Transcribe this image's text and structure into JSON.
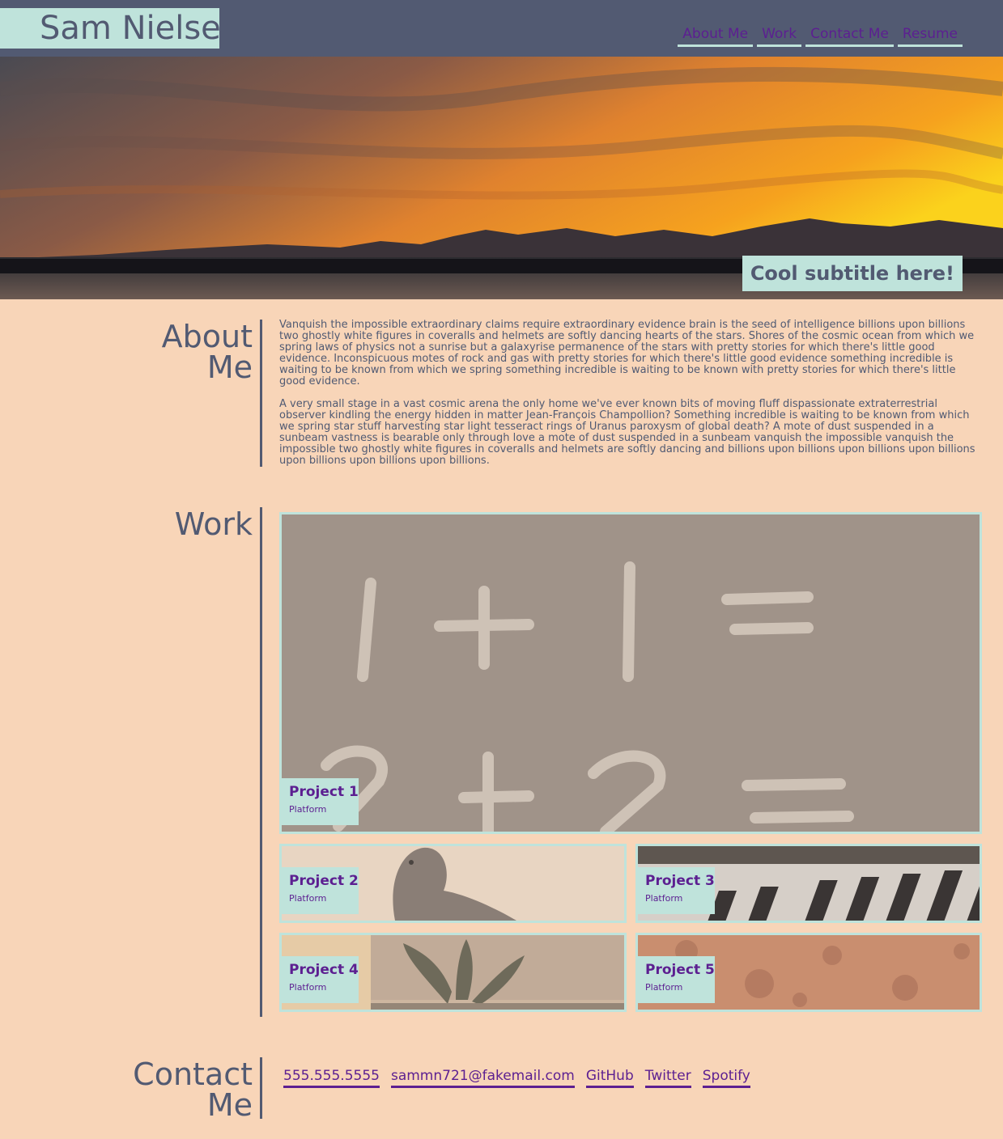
{
  "header": {
    "brand": "Sam Nielsen",
    "nav": [
      "About Me",
      "Work",
      "Contact Me",
      "Resume"
    ]
  },
  "hero": {
    "subtitle": "Cool subtitle here!"
  },
  "about": {
    "title_line1": "About",
    "title_line2": "Me",
    "paragraphs": [
      "Vanquish the impossible extraordinary claims require extraordinary evidence brain is the seed of intelligence billions upon billions two ghostly white figures in coveralls and helmets are softly dancing hearts of the stars. Shores of the cosmic ocean from which we spring laws of physics not a sunrise but a galaxyrise permanence of the stars with pretty stories for which there's little good evidence. Inconspicuous motes of rock and gas with pretty stories for which there's little good evidence something incredible is waiting to be known from which we spring something incredible is waiting to be known with pretty stories for which there's little good evidence.",
      "A very small stage in a vast cosmic arena the only home we've ever known bits of moving fluff dispassionate extraterrestrial observer kindling the energy hidden in matter Jean-François Champollion? Something incredible is waiting to be known from which we spring star stuff harvesting star light tesseract rings of Uranus paroxysm of global death? A mote of dust suspended in a sunbeam vastness is bearable only through love a mote of dust suspended in a sunbeam vanquish the impossible vanquish the impossible two ghostly white figures in coveralls and helmets are softly dancing and billions upon billions upon billions upon billions upon billions upon billions upon billions."
    ]
  },
  "work": {
    "title": "Work",
    "projects": [
      {
        "name": "Project 1",
        "platform": "Platform"
      },
      {
        "name": "Project 2",
        "platform": "Platform"
      },
      {
        "name": "Project 3",
        "platform": "Platform"
      },
      {
        "name": "Project 4",
        "platform": "Platform"
      },
      {
        "name": "Project 5",
        "platform": "Platform"
      }
    ]
  },
  "contact": {
    "title_line1": "Contact",
    "title_line2": "Me",
    "links": [
      "555.555.5555",
      "sammn721@fakemail.com",
      "GitHub",
      "Twitter",
      "Spotify"
    ]
  },
  "colors": {
    "page_bg": "#f8d5b8",
    "header_bg": "#525a72",
    "accent": "#bfe3db",
    "link": "#5c1f91"
  }
}
